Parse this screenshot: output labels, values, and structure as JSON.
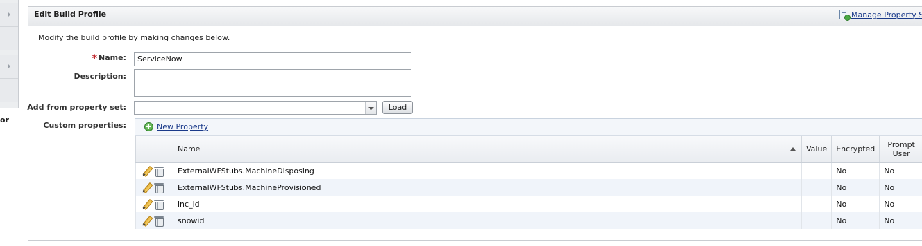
{
  "left_fragment": "or",
  "panel": {
    "title": "Edit Build Profile",
    "manage_link": "Manage Property Se"
  },
  "form": {
    "intro": "Modify the build profile by making changes below.",
    "required_marker": "*",
    "name_label": "Name:",
    "name_value": "ServiceNow",
    "description_label": "Description:",
    "description_value": "",
    "property_set_label": "Add from property set:",
    "property_set_value": "",
    "load_button": "Load",
    "custom_properties_label": "Custom properties:"
  },
  "properties": {
    "new_property_label": "New Property",
    "columns": [
      "Name",
      "Value",
      "Encrypted",
      "Prompt User"
    ],
    "sort_column": "Name",
    "rows": [
      {
        "name": "ExternalWFStubs.MachineDisposing",
        "value": "",
        "encrypted": "No",
        "prompt_user": "No"
      },
      {
        "name": "ExternalWFStubs.MachineProvisioned",
        "value": "",
        "encrypted": "No",
        "prompt_user": "No"
      },
      {
        "name": "inc_id",
        "value": "",
        "encrypted": "No",
        "prompt_user": "No"
      },
      {
        "name": "snowid",
        "value": "",
        "encrypted": "No",
        "prompt_user": "No"
      }
    ]
  }
}
